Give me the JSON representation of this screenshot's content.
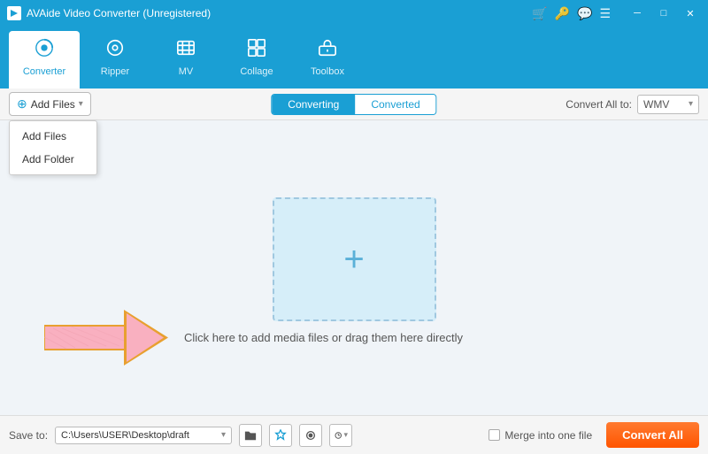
{
  "titleBar": {
    "title": "AVAide Video Converter (Unregistered)",
    "buttons": {
      "minimize": "─",
      "maximize": "□",
      "close": "✕"
    }
  },
  "navTabs": [
    {
      "id": "converter",
      "label": "Converter",
      "active": true
    },
    {
      "id": "ripper",
      "label": "Ripper",
      "active": false
    },
    {
      "id": "mv",
      "label": "MV",
      "active": false
    },
    {
      "id": "collage",
      "label": "Collage",
      "active": false
    },
    {
      "id": "toolbox",
      "label": "Toolbox",
      "active": false
    }
  ],
  "toolbar": {
    "addFilesLabel": "Add Files",
    "dropdownArrow": "▾",
    "convertingTab": "Converting",
    "convertedTab": "Converted",
    "convertAllToLabel": "Convert All to:",
    "format": "WMV",
    "formatArrow": "▾"
  },
  "dropdown": {
    "items": [
      {
        "label": "Add Files"
      },
      {
        "label": "Add Folder"
      }
    ]
  },
  "mainArea": {
    "hintText": "Click here to add media files or drag them here directly",
    "plusSymbol": "+"
  },
  "bottomBar": {
    "saveToLabel": "Save to:",
    "savePath": "C:\\Users\\USER\\Desktop\\draft",
    "mergeLabel": "Merge into one file",
    "convertAllLabel": "Convert All"
  }
}
